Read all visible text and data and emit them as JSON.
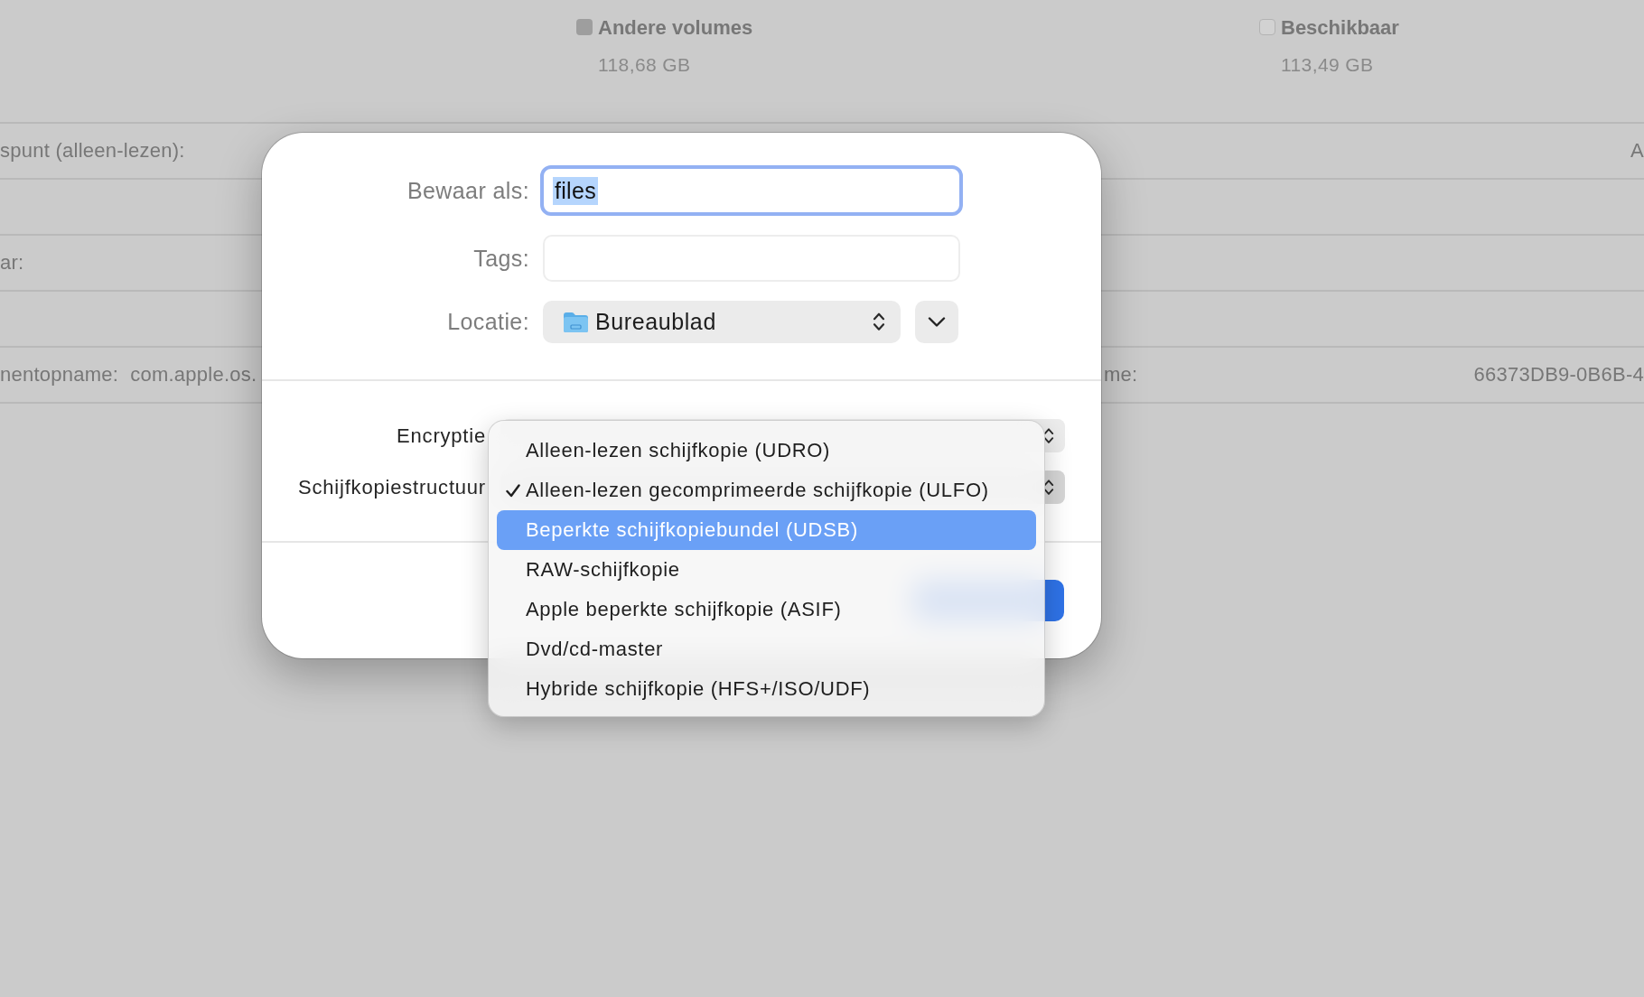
{
  "background": {
    "legend": [
      {
        "kind": "filled",
        "color": "#9e9e9e",
        "title": "Andere volumes",
        "value": "118,68 GB"
      },
      {
        "kind": "outline",
        "color": "#d2d2d2",
        "title": "Beschikbaar",
        "value": "113,49 GB"
      }
    ],
    "info_rows": [
      {
        "left_label": "spunt (alleen-lezen):",
        "right_value": "A"
      },
      {},
      {
        "left_label": "ar:"
      },
      {},
      {
        "left_label": "nentopname:",
        "left_value": "com.apple.os.",
        "right_label": "me:",
        "right_value": "66373DB9-0B6B-4"
      }
    ]
  },
  "dialog": {
    "save_as": {
      "label": "Bewaar als:",
      "value": "files",
      "focused": true,
      "text_selected": true
    },
    "tags": {
      "label": "Tags:"
    },
    "location": {
      "label": "Locatie:",
      "value": "Bureaublad",
      "expanded": false
    },
    "options": [
      {
        "label": "Encryptie",
        "menu_open": false
      },
      {
        "label": "Schijfkopiestructuur",
        "menu_open": true
      }
    ]
  },
  "menu": {
    "items": [
      {
        "label": "Alleen-lezen schijfkopie (UDRO)",
        "selected": false,
        "highlighted": false
      },
      {
        "label": "Alleen-lezen gecomprimeerde schijfkopie (ULFO)",
        "selected": true,
        "highlighted": false
      },
      {
        "label": "Beperkte schijfkopiebundel (UDSB)",
        "selected": false,
        "highlighted": true
      },
      {
        "label": "RAW-schijfkopie",
        "selected": false,
        "highlighted": false
      },
      {
        "label": "Apple beperkte schijfkopie (ASIF)",
        "selected": false,
        "highlighted": false
      },
      {
        "label": "Dvd/cd-master",
        "selected": false,
        "highlighted": false
      },
      {
        "label": "Hybride schijfkopie (HFS+/ISO/UDF)",
        "selected": false,
        "highlighted": false
      }
    ]
  }
}
